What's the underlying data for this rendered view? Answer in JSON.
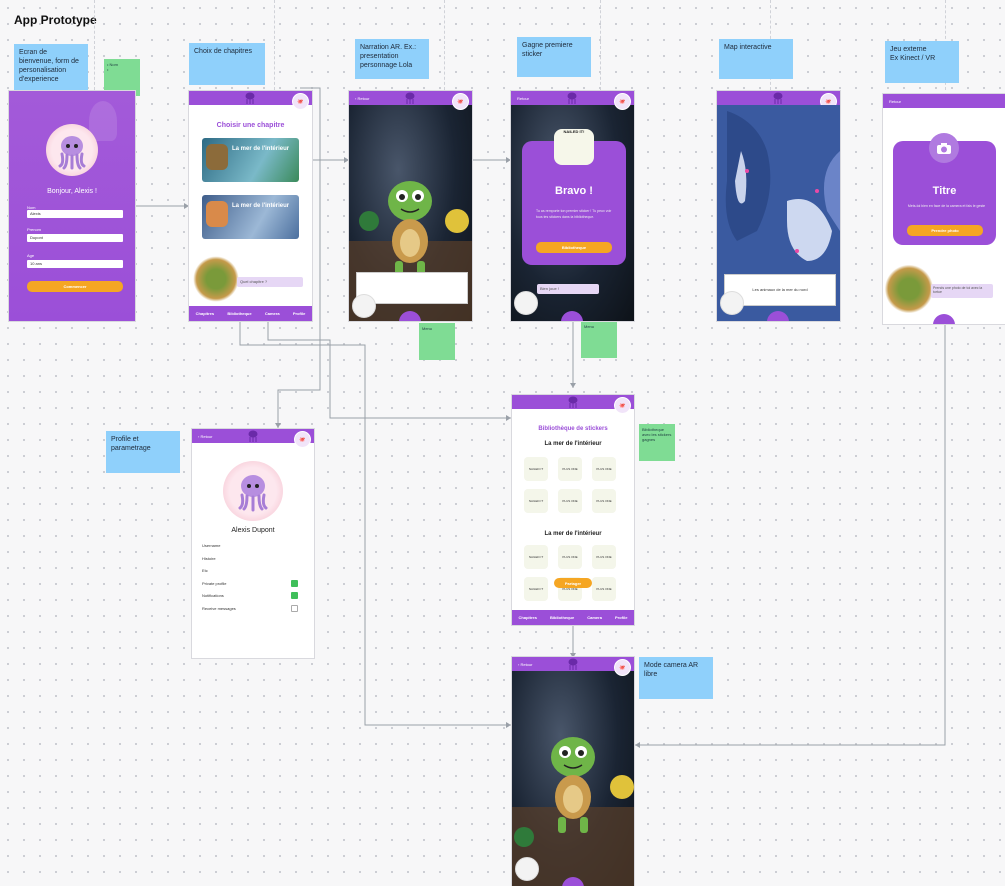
{
  "page_title": "App Prototype",
  "colors": {
    "purple": "#9b4fd8",
    "orange": "#f5a623",
    "note_blue": "#8fd0fb",
    "note_green": "#7fdc94"
  },
  "notes": {
    "welcome": "Ecran de bienvenue, form de personalisation d'experience",
    "chapters": "Choix de chapitres",
    "narration": "Narration AR. Ex.: presentation personnage Lola",
    "sticker": "Gagne premiere sticker",
    "map": "Map interactive",
    "external": "Jeu externe\nEx Kinect / VR",
    "profile": "Profile et parametrage",
    "camera_mode": "Mode camera AR libre"
  },
  "green_notes": {
    "g1": "• Nom\n•",
    "g2": "Menu",
    "g3": "Menu",
    "g4": "Bibliotheque avec les stickers gagnes"
  },
  "screens": {
    "welcome": {
      "greeting": "Bonjour, Alexis !",
      "fields": [
        {
          "label": "Nom",
          "value": "Alexis"
        },
        {
          "label": "Prenom",
          "value": "Dupont"
        },
        {
          "label": "Age",
          "value": "10 ans"
        }
      ],
      "button": "Commencer"
    },
    "chapters": {
      "heading": "Choisir une chapitre",
      "cards": [
        "La mer de l'intérieur",
        "La mer de l'intérieur"
      ],
      "bubble": "Quel chapitre ?",
      "tabs": [
        "Chapitres",
        "Bibliotheque",
        "Camera",
        "Profile"
      ]
    },
    "narration": {
      "back": "Retour"
    },
    "bravo": {
      "back": "Retour",
      "sticker_text": "NAILED IT!",
      "title": "Bravo !",
      "body": "Tu as remporte ton premier sticker ! Tu peux voir tous tes stickers dans la bibliotheque.",
      "button": "Bibliotheque",
      "bubble": "Bien joue !"
    },
    "map": {
      "caption": "Les animaux de la mer du nord"
    },
    "external": {
      "back": "Retour",
      "title": "Titre",
      "body": "Mets-toi bien en face de la camera et fais le geste",
      "button": "Prendre photo",
      "bubble": "Prends une photo de toi avec la tortue"
    },
    "profile": {
      "back": "Retour",
      "name": "Alexis Dupont",
      "rows": [
        {
          "label": "Username",
          "check": null
        },
        {
          "label": "Histoire",
          "check": null
        },
        {
          "label": "Etc",
          "check": null
        },
        {
          "label": "Private profile",
          "check": true
        },
        {
          "label": "Notifications",
          "check": true
        },
        {
          "label": "Receive messages",
          "check": false
        }
      ]
    },
    "library": {
      "heading": "Bibliothèque de stickers",
      "section1": "La mer de l'intérieur",
      "section2": "La mer de l'intérieur",
      "stickers": [
        "NAILED IT",
        "PLUS ONE",
        "PLUS ONE"
      ],
      "button": "Partager",
      "tabs": [
        "Chapitres",
        "Bibliotheque",
        "Camera",
        "Profile"
      ]
    },
    "camera": {
      "back": "Retour"
    }
  }
}
